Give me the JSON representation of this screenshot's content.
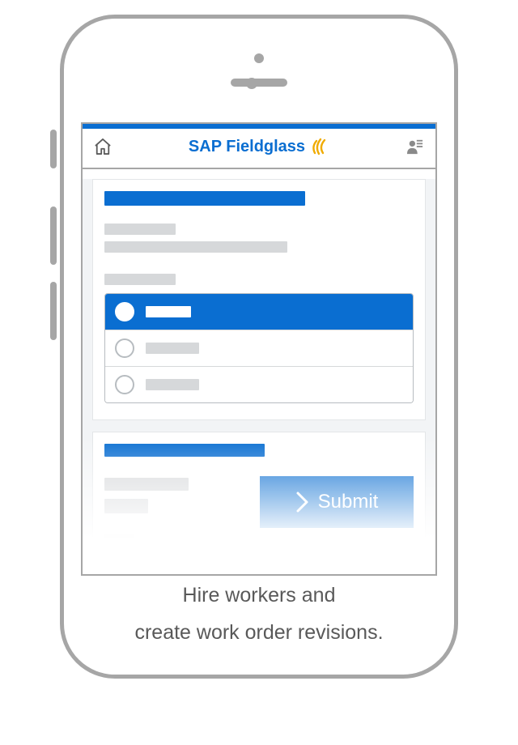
{
  "header": {
    "brand_text": "SAP Fieldglass"
  },
  "actions": {
    "submit_label": "Submit"
  },
  "caption": {
    "line1": "Hire workers and",
    "line2": "create work order revisions."
  },
  "colors": {
    "accent": "#0a6ed1",
    "swirl": "#f0ab00",
    "frame": "#a6a6a6",
    "placeholder": "#d6d8da"
  }
}
